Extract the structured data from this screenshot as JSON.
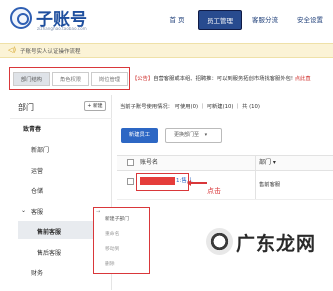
{
  "header": {
    "logo_title": "子账号",
    "logo_subtitle": "zizhanghao.taobao.com",
    "nav": [
      "首 页",
      "员工管理",
      "客服分流",
      "安全设置"
    ],
    "nav_active_index": 1,
    "brand_color": "#1f4f9e",
    "nav_active_color": "#284b8f"
  },
  "notice": {
    "icon": "speaker-icon",
    "text": "子账号实人认证操作流程"
  },
  "tabs": [
    "部门结构",
    "角色权限",
    "岗位管理"
  ],
  "announcement": {
    "tag": "【公告】",
    "text": "自营客服或本组、招聘推：可以到服务拓创市场找客服外包!",
    "link": "点此直"
  },
  "sidebar": {
    "title": "部门",
    "new_button": "+ 新建",
    "tree": [
      {
        "label": "致青春",
        "bold": true
      },
      {
        "label": "新部门",
        "bold": false
      },
      {
        "label": "运营",
        "bold": false
      },
      {
        "label": "仓储",
        "bold": false
      },
      {
        "label": "客服",
        "bold": false,
        "expanded": true
      },
      {
        "label": "售前客服",
        "bold": true,
        "selected": true
      },
      {
        "label": "售后客服",
        "bold": false
      },
      {
        "label": "财务",
        "bold": false
      }
    ]
  },
  "stats": {
    "text": "当前子账号使用情况： 可使用(0)  ｜  可新建(10)  ｜  共 (10)"
  },
  "toolbar": {
    "new_employee": "新建员工",
    "move_dept": "更换部门至",
    "move_dept_icon": "chevron-down-icon"
  },
  "table": {
    "columns": [
      "账号名",
      "部门 ▾"
    ],
    "rows": [
      {
        "account_suffix": "1:售儿",
        "department": "售前客服"
      }
    ]
  },
  "annotation": {
    "click_label": "点击",
    "highlight_color": "#d9373a"
  },
  "context_menu": {
    "items": [
      "新建子部门",
      "重命名",
      "移动到",
      "删除"
    ]
  },
  "watermark": {
    "text": "广东龙网"
  }
}
